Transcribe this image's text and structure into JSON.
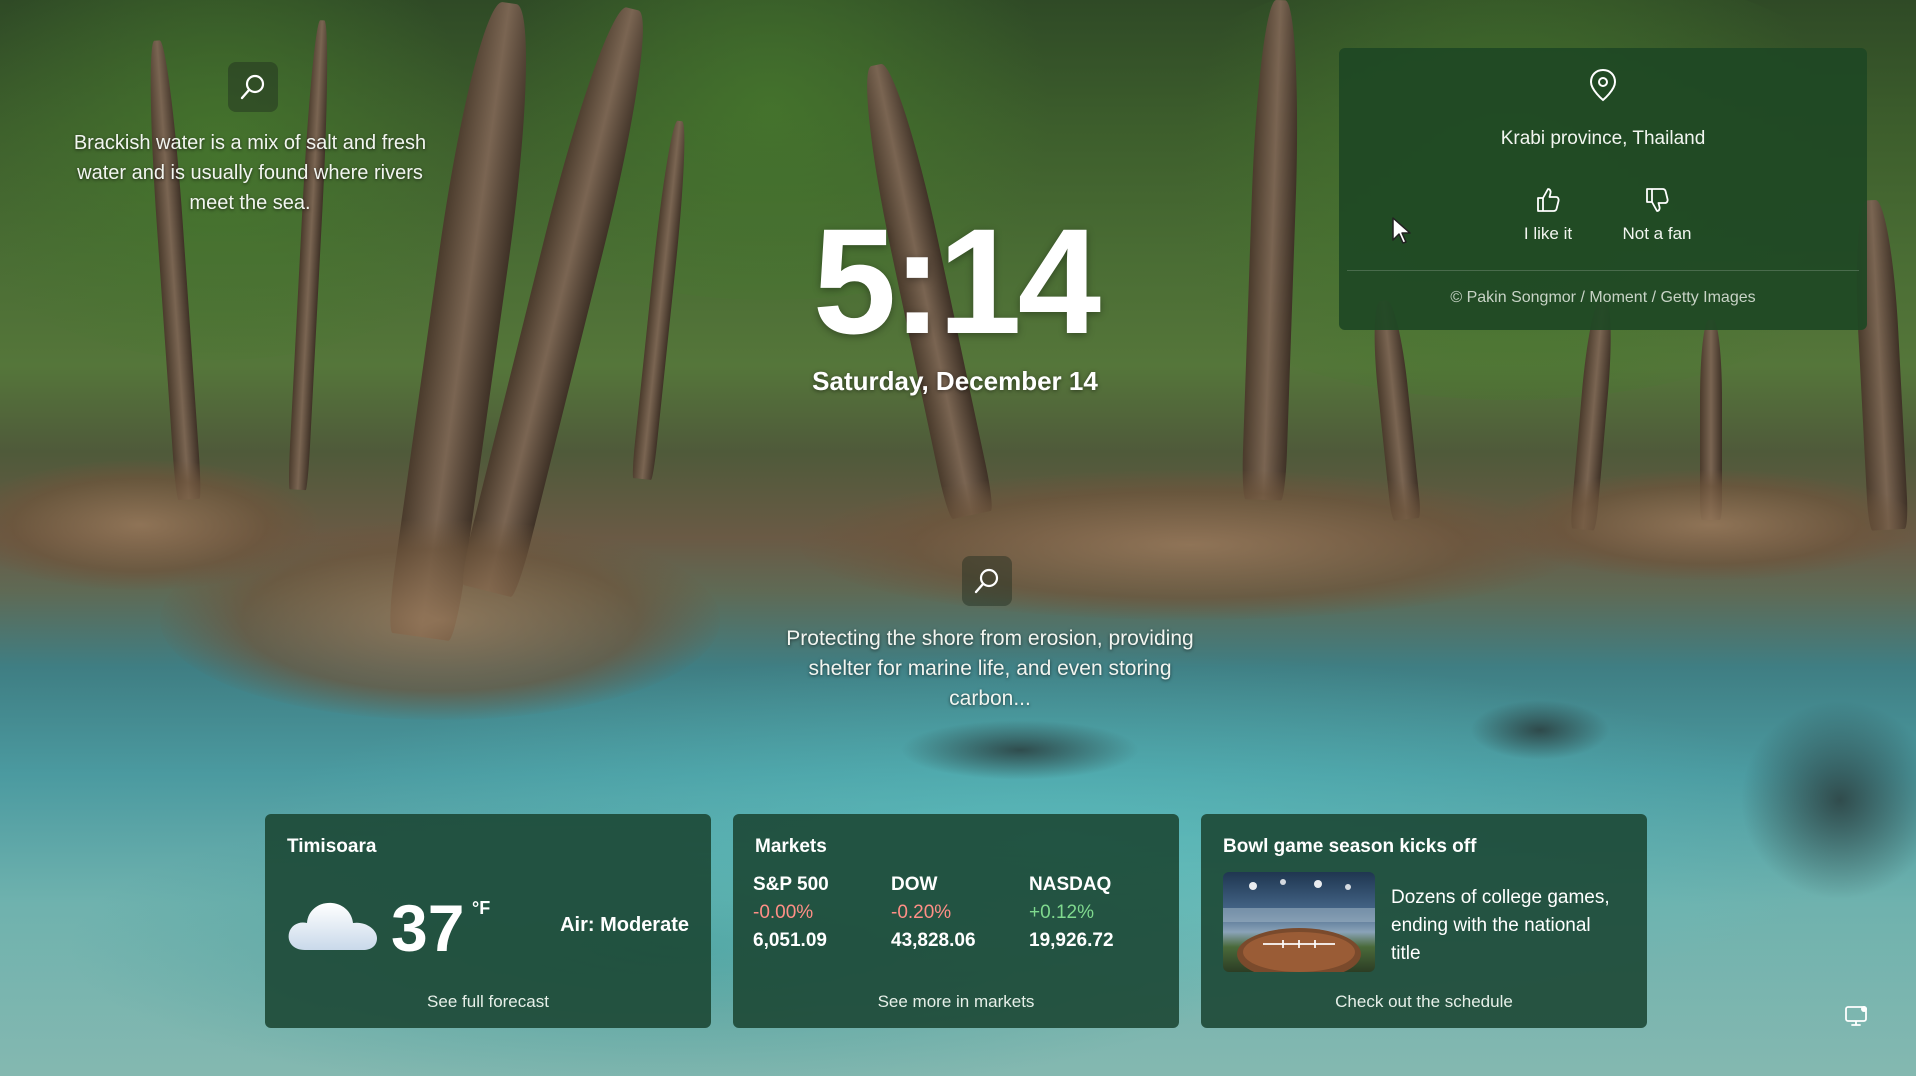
{
  "background": {
    "fact_top": "Brackish water is a mix of salt and fresh water and is usually found where rivers meet the sea.",
    "fact_middle": "Protecting the shore from erosion, providing shelter for marine life, and even storing carbon..."
  },
  "clock": {
    "time": "5:14",
    "date": "Saturday, December 14"
  },
  "spotlight": {
    "location": "Krabi province, Thailand",
    "like_label": "I like it",
    "dislike_label": "Not a fan",
    "credit": "© Pakin Songmor / Moment / Getty Images"
  },
  "weather": {
    "city": "Timisoara",
    "temperature": "37",
    "unit": "°F",
    "air_quality": "Air: Moderate",
    "icon": "cloud-icon",
    "link": "See full forecast"
  },
  "markets": {
    "title": "Markets",
    "indices": [
      {
        "name": "S&P 500",
        "change": "-0.00%",
        "value": "6,051.09",
        "direction": "down"
      },
      {
        "name": "DOW",
        "change": "-0.20%",
        "value": "43,828.06",
        "direction": "down"
      },
      {
        "name": "NASDAQ",
        "change": "+0.12%",
        "value": "19,926.72",
        "direction": "up"
      }
    ],
    "link": "See more in markets"
  },
  "news": {
    "title": "Bowl game season kicks off",
    "summary": "Dozens of college games, ending with the national title",
    "link": "Check out the schedule"
  },
  "colors": {
    "card_green": "#1e4824",
    "widget_green": "#1a4632",
    "negative": "#ff8f86",
    "positive": "#7fd98e"
  }
}
